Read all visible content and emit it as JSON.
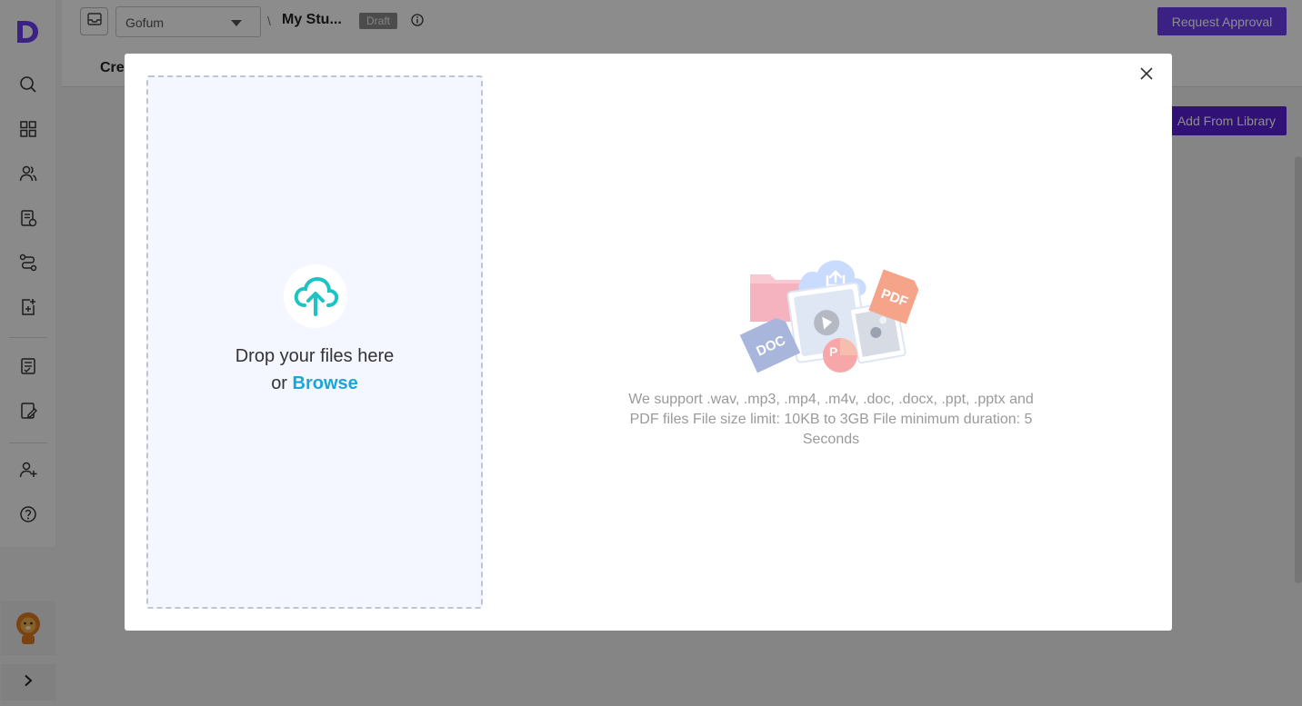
{
  "app": {
    "logo_letter": "D",
    "brand_color": "#6e3cf0"
  },
  "sidebar": {
    "items": [
      {
        "icon": "search-icon"
      },
      {
        "icon": "grid-icon"
      },
      {
        "icon": "users-icon"
      },
      {
        "icon": "document-check-icon"
      },
      {
        "icon": "route-icon"
      },
      {
        "icon": "add-document-icon"
      },
      {
        "icon": "list-check-icon"
      },
      {
        "icon": "edit-document-icon"
      },
      {
        "icon": "add-user-icon"
      },
      {
        "icon": "help-icon"
      }
    ],
    "expand_icon": "chevron-right-icon"
  },
  "header": {
    "org_selected": "Gofum",
    "breadcrumb_separator": "\\",
    "study_title": "My Stu...",
    "status_badge": "Draft",
    "request_approval_label": "Request Approval",
    "active_tab": "Cre"
  },
  "content": {
    "add_from_library_label": "Add From Library"
  },
  "upload_modal": {
    "drop_text": "Drop your files here",
    "or_text": "or",
    "browse_label": "Browse",
    "upload_icon_color": "#1cc4c4",
    "support_text": "We support .wav, .mp3, .mp4, .m4v, .doc, .docx, .ppt, .pptx and PDF files File size limit: 10KB to 3GB File minimum duration: 5 Seconds",
    "illustration": {
      "doc_label": "DOC",
      "pdf_label": "PDF",
      "ppt_label": "P"
    }
  }
}
